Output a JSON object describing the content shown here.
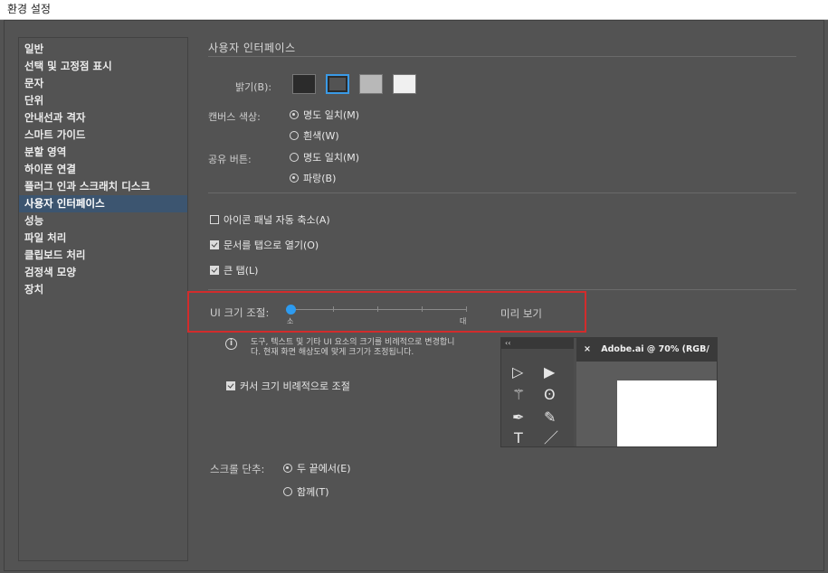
{
  "window": {
    "title": "환경 설정"
  },
  "sidebar": {
    "items": [
      {
        "label": "일반",
        "selected": false
      },
      {
        "label": "선택 및 고정점 표시",
        "selected": false
      },
      {
        "label": "문자",
        "selected": false
      },
      {
        "label": "단위",
        "selected": false
      },
      {
        "label": "안내선과 격자",
        "selected": false
      },
      {
        "label": "스마트 가이드",
        "selected": false
      },
      {
        "label": "분할 영역",
        "selected": false
      },
      {
        "label": "하이픈 연결",
        "selected": false
      },
      {
        "label": "플러그 인과 스크래치 디스크",
        "selected": false
      },
      {
        "label": "사용자 인터페이스",
        "selected": true
      },
      {
        "label": "성능",
        "selected": false
      },
      {
        "label": "파일 처리",
        "selected": false
      },
      {
        "label": "클립보드 처리",
        "selected": false
      },
      {
        "label": "검정색 모양",
        "selected": false
      },
      {
        "label": "장치",
        "selected": false
      }
    ]
  },
  "main": {
    "section_title": "사용자 인터페이스",
    "brightness": {
      "label": "밝기(B):",
      "swatches": [
        "#2b2b2b",
        "#535353",
        "#b8b8b8",
        "#f0f0f0"
      ],
      "selected_index": 1,
      "selected_border": "#3a9ae6"
    },
    "canvas_color": {
      "label": "캔버스 색상:",
      "options": [
        {
          "label": "명도 일치(M)",
          "checked": true
        },
        {
          "label": "흰색(W)",
          "checked": false
        }
      ]
    },
    "share_button": {
      "label": "공유 버튼:",
      "options": [
        {
          "label": "명도 일치(M)",
          "checked": false
        },
        {
          "label": "파랑(B)",
          "checked": true
        }
      ]
    },
    "checkboxes": [
      {
        "label": "아이콘 패널 자동 축소(A)",
        "checked": false
      },
      {
        "label": "문서를 탭으로 열기(O)",
        "checked": true
      },
      {
        "label": "큰 탭(L)",
        "checked": true
      }
    ],
    "ui_scale": {
      "label": "UI 크기 조절:",
      "min_label": "소",
      "max_label": "대",
      "preview_label": "미리 보기",
      "value": 0,
      "highlight_color": "#d22c2c",
      "thumb_color": "#2d9bf0"
    },
    "info_text": "도구, 텍스트 및 기타 UI 요소의 크기를 비례적으로 변경합니다. 현재 화면 해상도에 맞게 크기가 조정됩니다.",
    "cursor_scale": {
      "label": "커서 크기 비례적으로 조절",
      "checked": true
    },
    "preview": {
      "panel_header": "‹‹",
      "tab_close": "×",
      "tab_title": "Adobe.ai @ 70% (RGB/"
    },
    "scroll_buttons": {
      "label": "스크롤 단추:",
      "options": [
        {
          "label": "두 끝에서(E)",
          "checked": true
        },
        {
          "label": "함께(T)",
          "checked": false
        }
      ]
    }
  }
}
